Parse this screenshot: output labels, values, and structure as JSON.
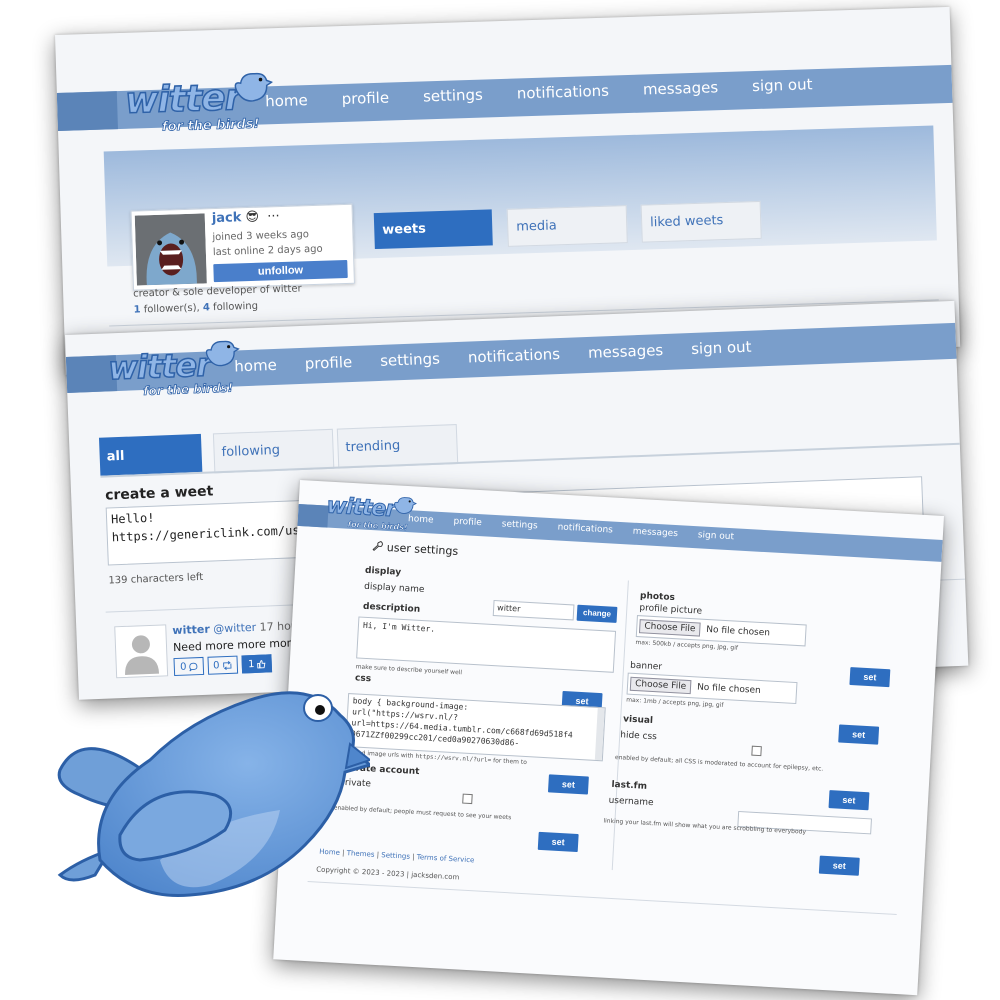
{
  "profile_page": {
    "logo": {
      "word": "witter",
      "tagline": "for the birds!"
    },
    "nav": [
      "home",
      "profile",
      "settings",
      "notifications",
      "messages",
      "sign out"
    ],
    "user": {
      "name": "jack",
      "emoji": "😎",
      "more": "···",
      "joined": "joined 3 weeks ago",
      "last_online": "last online 2 days ago",
      "unfollow_label": "unfollow"
    },
    "tabs": [
      "weets",
      "media",
      "liked weets"
    ],
    "bio": "creator & sole developer of witter",
    "followers_count": "1",
    "followers_label": "follower(s),",
    "following_count": "4",
    "following_label": "following"
  },
  "timeline_page": {
    "logo": {
      "word": "witter",
      "tagline": "for the birds!"
    },
    "nav": [
      "home",
      "profile",
      "settings",
      "notifications",
      "messages",
      "sign out"
    ],
    "tabs": [
      "all",
      "following",
      "trending"
    ],
    "composer": {
      "heading": "create a weet",
      "text_line1": "Hello!",
      "text_line2": "https://genericlink.com/user/witter/5",
      "chars_left": "139 characters left"
    },
    "post": {
      "author": "witter",
      "handle": "@witter",
      "time": "17 hours ago",
      "text": "Need more more more!!!!!! Need mo",
      "reply_count": "0",
      "reweet_count": "0",
      "like_count": "1"
    }
  },
  "settings_page": {
    "logo": {
      "word": "witter",
      "tagline": "for the birds!"
    },
    "nav": [
      "home",
      "profile",
      "settings",
      "notifications",
      "messages",
      "sign out"
    ],
    "title": "user settings",
    "display": {
      "heading": "display",
      "label": "display name",
      "value": "witter",
      "button": "change"
    },
    "description": {
      "heading": "description",
      "value": "Hi, I'm Witter.",
      "hint": "make sure to describe yourself well"
    },
    "css": {
      "heading": "css",
      "line1": "body { background-image:",
      "line2": "url(\"https://wsrv.nl/?",
      "line3": "url=https://64.media.tumblr.com/c668fd69d518f4",
      "line4": "0671ZZf00299cc201/ced0a90270630d86-",
      "hint_a": "append image urls with ",
      "hint_code": "https://wsrv.nl/?url=",
      "hint_b": " for them to",
      "button": "set"
    },
    "private": {
      "heading": "private account",
      "label": "private",
      "hint": "enabled by default; people must request to see your weets",
      "button": "set"
    },
    "photos": {
      "heading": "photos",
      "profile_label": "profile picture",
      "choose": "Choose File",
      "no_file": "No file chosen",
      "profile_hint": "max: 500kb / accepts png, jpg, gif",
      "banner_label": "banner",
      "banner_hint": "max: 1mb / accepts png, jpg, gif",
      "button": "set"
    },
    "visual": {
      "heading": "visual",
      "label": "hide css",
      "hint": "enabled by default; all CSS is moderated to account for epilepsy, etc.",
      "button": "set"
    },
    "lastfm": {
      "heading": "last.fm",
      "label": "username",
      "hint": "linking your last.fm will show what you are scrobbling to everybody",
      "button": "set"
    },
    "footer": {
      "links": [
        "Home",
        "Themes",
        "Settings",
        "Terms of Service"
      ],
      "copyright": "Copyright © 2023 - 2023 | jacksden.com"
    }
  },
  "colors": {
    "nav_bar": "#7a9ecb",
    "nav_dark": "#5b84b8",
    "button_blue": "#2e6ec0",
    "bird_blue": "#6f9fd8",
    "link_blue": "#3f72b8"
  }
}
